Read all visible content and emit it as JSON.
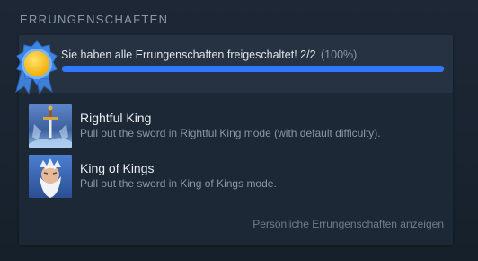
{
  "section": {
    "title": "ERRUNGENSCHAFTEN"
  },
  "summary": {
    "text": "Sie haben alle Errungenschaften freigeschaltet! 2/2",
    "percent_text": "(100%)",
    "progress_fraction": 1.0,
    "badge_icon": "sun-ribbon-badge-icon",
    "accent_color": "#2f78ff"
  },
  "achievements": [
    {
      "title": "Rightful King",
      "description": "Pull out the sword in Rightful King mode (with default difficulty).",
      "icon": "sword-achievement-icon"
    },
    {
      "title": "King of Kings",
      "description": "Pull out the sword in King of Kings mode.",
      "icon": "king-portrait-achievement-icon"
    }
  ],
  "footer": {
    "link_label": "Persönliche Errungenschaften anzeigen"
  }
}
